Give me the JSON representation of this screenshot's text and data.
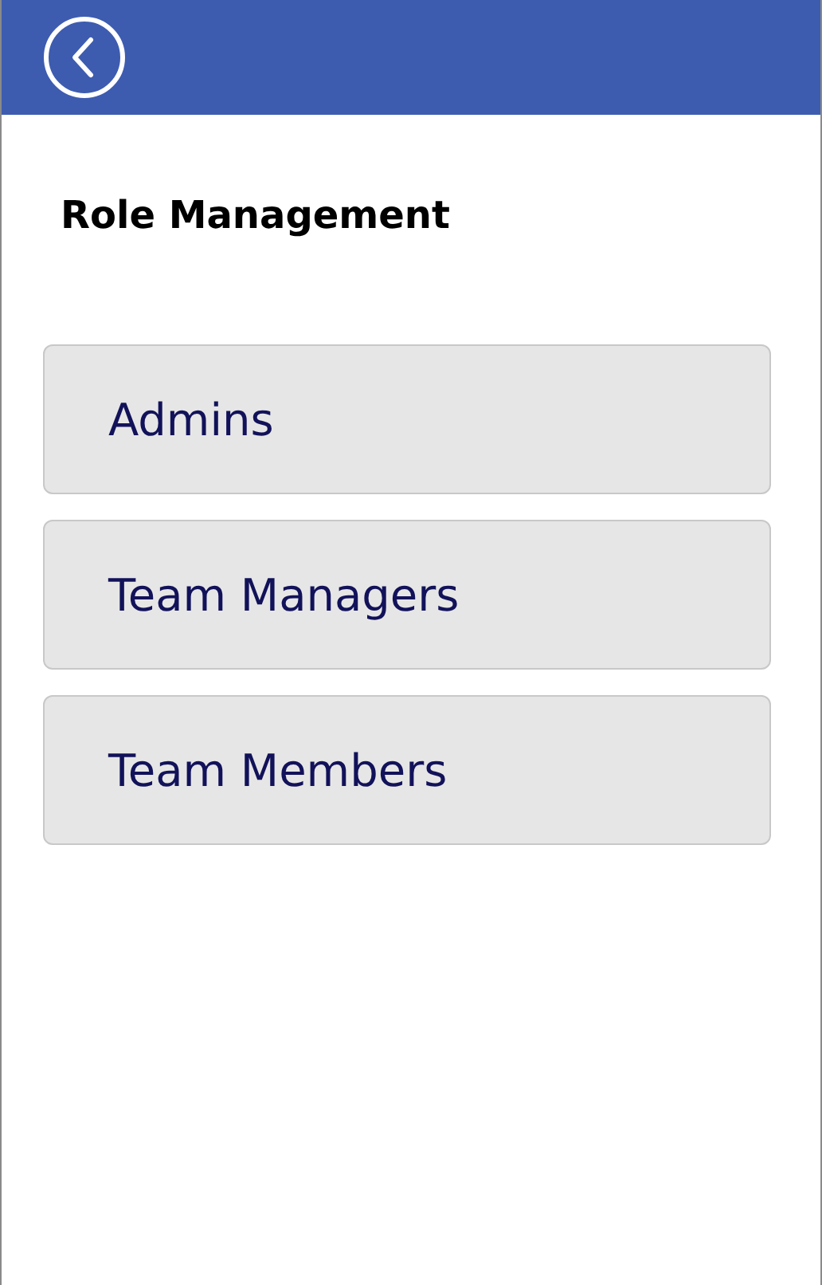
{
  "header": {
    "back_button": true
  },
  "title": "Role Management",
  "roles": [
    {
      "label": "Admins"
    },
    {
      "label": "Team Managers"
    },
    {
      "label": "Team Members"
    }
  ]
}
